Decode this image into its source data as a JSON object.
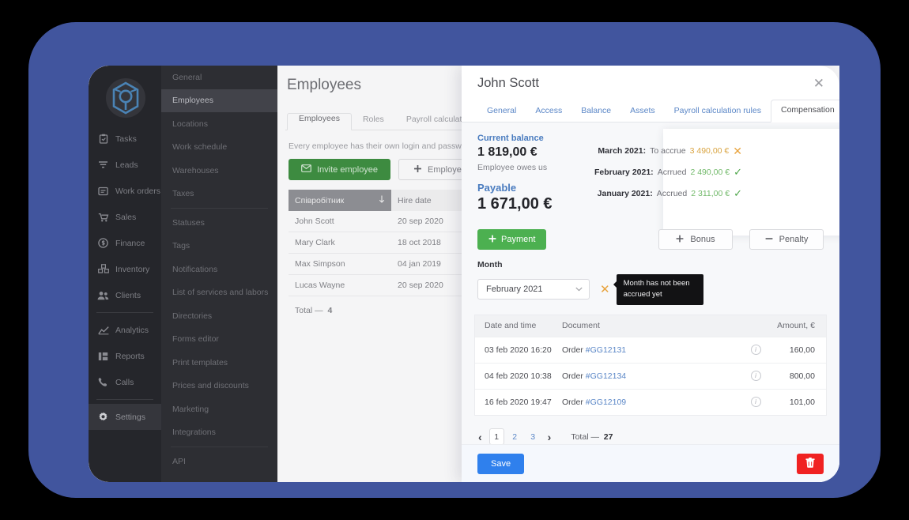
{
  "theme": {
    "frame_blue": "#41559e",
    "accent_blue": "#2f80ed",
    "link_blue": "#5b87c7",
    "green": "#4cb050",
    "pending_orange": "#d9a441",
    "danger_red": "#f02222"
  },
  "primary_nav": {
    "logo_icon": "cube-logo-icon",
    "items": [
      {
        "label": "Tasks",
        "icon": "clipboard-icon",
        "active": false
      },
      {
        "label": "Leads",
        "icon": "funnel-icon",
        "active": false
      },
      {
        "label": "Work orders",
        "icon": "work-order-icon",
        "active": false
      },
      {
        "label": "Sales",
        "icon": "cart-icon",
        "active": false
      },
      {
        "label": "Finance",
        "icon": "coin-icon",
        "active": false
      },
      {
        "label": "Inventory",
        "icon": "boxes-icon",
        "active": false
      },
      {
        "label": "Clients",
        "icon": "people-icon",
        "active": false
      },
      {
        "label": "Analytics",
        "icon": "chart-icon",
        "active": false
      },
      {
        "label": "Reports",
        "icon": "report-icon",
        "active": false
      },
      {
        "label": "Calls",
        "icon": "phone-icon",
        "active": false
      },
      {
        "label": "Settings",
        "icon": "gear-icon",
        "active": true
      }
    ]
  },
  "secondary_nav": {
    "items": [
      {
        "label": "General",
        "active": false
      },
      {
        "label": "Employees",
        "active": true
      },
      {
        "label": "Locations",
        "active": false
      },
      {
        "label": "Work schedule",
        "active": false
      },
      {
        "label": "Warehouses",
        "active": false
      },
      {
        "label": "Taxes",
        "active": false
      },
      {
        "label": "Statuses",
        "active": false
      },
      {
        "label": "Tags",
        "active": false
      },
      {
        "label": "Notifications",
        "active": false
      },
      {
        "label": "List of services and labors",
        "active": false
      },
      {
        "label": "Directories",
        "active": false
      },
      {
        "label": "Forms editor",
        "active": false
      },
      {
        "label": "Print templates",
        "active": false
      },
      {
        "label": "Prices and discounts",
        "active": false
      },
      {
        "label": "Marketing",
        "active": false
      },
      {
        "label": "Integrations",
        "active": false
      },
      {
        "label": "API",
        "active": false
      }
    ]
  },
  "main": {
    "title": "Employees",
    "tabs": [
      {
        "label": "Employees",
        "active": true
      },
      {
        "label": "Roles",
        "active": false
      },
      {
        "label": "Payroll calculation rules",
        "active": false
      }
    ],
    "description": "Every employee has their own login and password for ente",
    "invite_button": "Invite employee",
    "invite_icon": "envelope-icon",
    "add_employee_button": "Employee",
    "add_icon": "plus-icon",
    "table": {
      "columns": [
        "Співробітник",
        "Hire date"
      ],
      "sort_icon_name": "arrow-down-icon",
      "sort_icon_date": "sort-updown-icon",
      "rows": [
        {
          "name": "John Scott",
          "hire_date": "20 sep 2020"
        },
        {
          "name": "Mary Clark",
          "hire_date": "18 oct 2018"
        },
        {
          "name": "Max Simpson",
          "hire_date": "04 jan 2019"
        },
        {
          "name": "Lucas Wayne",
          "hire_date": "20 sep 2020"
        }
      ],
      "total_label": "Total —",
      "total_value": "4"
    }
  },
  "modal": {
    "title": "John Scott",
    "close_icon": "close-icon",
    "tabs": [
      {
        "label": "General",
        "active": false
      },
      {
        "label": "Access",
        "active": false
      },
      {
        "label": "Balance",
        "active": false
      },
      {
        "label": "Assets",
        "active": false
      },
      {
        "label": "Payroll calculation rules",
        "active": false
      },
      {
        "label": "Compensation",
        "active": true
      }
    ],
    "balance": {
      "current_label": "Current balance",
      "current_amount": "1 819,00 €",
      "current_note": "Employee owes us",
      "payable_label": "Payable",
      "payable_amount": "1 671,00 €"
    },
    "accruals": [
      {
        "month": "March 2021:",
        "state": "To accrue",
        "amount": "3 490,00 €",
        "status": "pending",
        "status_icon": "cross-icon"
      },
      {
        "month": "February 2021:",
        "state": "Acrrued",
        "amount": "2 490,00 €",
        "status": "done",
        "status_icon": "check-icon"
      },
      {
        "month": "January 2021:",
        "state": "Accrued",
        "amount": "2 311,00 €",
        "status": "done",
        "status_icon": "check-icon"
      }
    ],
    "actions": {
      "payment": "Payment",
      "payment_icon": "plus-icon",
      "bonus": "Bonus",
      "bonus_icon": "plus-icon",
      "penalty": "Penalty",
      "penalty_icon": "minus-icon"
    },
    "month_picker": {
      "label": "Month",
      "value": "February 2021",
      "chevron_icon": "chevron-down-icon",
      "clear_icon": "cross-icon",
      "tooltip": "Month has not been accrued yet"
    },
    "transactions": {
      "columns": [
        "Date and time",
        "Document",
        "",
        "Amount, €"
      ],
      "rows": [
        {
          "datetime": "03 feb 2020 16:20",
          "doc_prefix": "Order",
          "doc_link": "#GG12131",
          "info_icon": "info-icon",
          "amount": "160,00"
        },
        {
          "datetime": "04 feb 2020 10:38",
          "doc_prefix": "Order",
          "doc_link": "#GG12134",
          "info_icon": "info-icon",
          "amount": "800,00"
        },
        {
          "datetime": "16 feb 2020 19:47",
          "doc_prefix": "Order",
          "doc_link": "#GG12109",
          "info_icon": "info-icon",
          "amount": "101,00"
        }
      ]
    },
    "pagination": {
      "prev_icon": "chevron-left-icon",
      "next_icon": "chevron-right-icon",
      "pages": [
        "1",
        "2",
        "3"
      ],
      "current": "1",
      "total_label": "Total —",
      "total_value": "27"
    },
    "footer": {
      "save": "Save",
      "delete_icon": "trash-icon"
    }
  }
}
